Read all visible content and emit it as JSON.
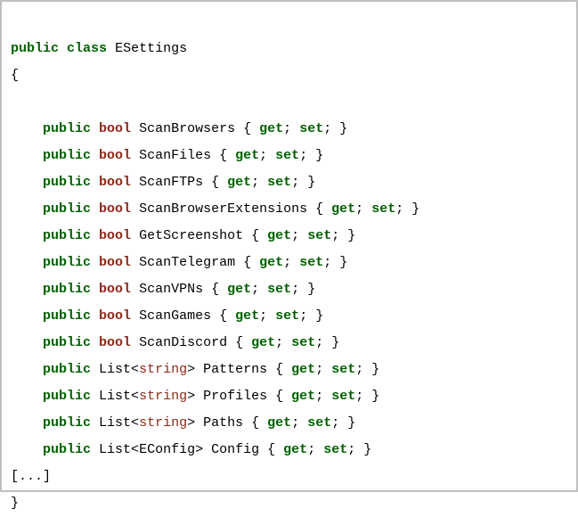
{
  "keywords": {
    "public": "public",
    "class": "class",
    "get": "get",
    "set": "set"
  },
  "types": {
    "bool": "bool",
    "list": "List",
    "string": "string",
    "econfig": "EConfig"
  },
  "class_name": "ESettings",
  "punct": {
    "open_brace": "{",
    "close_brace": "}",
    "semicolon": ";",
    "lt": "<",
    "gt": ">",
    "ellipsis": "[...]"
  },
  "properties": [
    {
      "type": "bool",
      "name": "ScanBrowsers"
    },
    {
      "type": "bool",
      "name": "ScanFiles"
    },
    {
      "type": "bool",
      "name": "ScanFTPs"
    },
    {
      "type": "bool",
      "name": "ScanBrowserExtensions"
    },
    {
      "type": "bool",
      "name": "GetScreenshot"
    },
    {
      "type": "bool",
      "name": "ScanTelegram"
    },
    {
      "type": "bool",
      "name": "ScanVPNs"
    },
    {
      "type": "bool",
      "name": "ScanGames"
    },
    {
      "type": "bool",
      "name": "ScanDiscord"
    },
    {
      "type": "List<string>",
      "name": "Patterns"
    },
    {
      "type": "List<string>",
      "name": "Profiles"
    },
    {
      "type": "List<string>",
      "name": "Paths"
    },
    {
      "type": "List<EConfig>",
      "name": "Config"
    }
  ]
}
